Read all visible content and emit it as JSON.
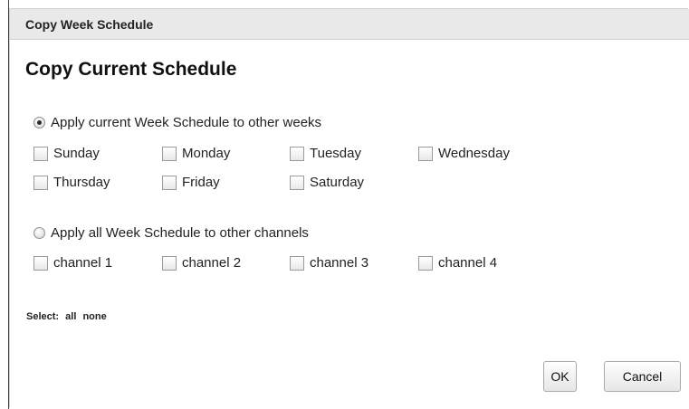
{
  "dialog": {
    "title": "Copy Week Schedule",
    "heading": "Copy Current Schedule"
  },
  "weeks_option": {
    "label": "Apply current Week Schedule to other weeks",
    "selected": true,
    "days": [
      "Sunday",
      "Monday",
      "Tuesday",
      "Wednesday",
      "Thursday",
      "Friday",
      "Saturday"
    ]
  },
  "channels_option": {
    "label": "Apply all Week Schedule to other channels",
    "selected": false,
    "channels": [
      "channel 1",
      "channel 2",
      "channel 3",
      "channel 4"
    ]
  },
  "select": {
    "label": "Select:",
    "all": "all",
    "none": "none"
  },
  "buttons": {
    "ok": "OK",
    "cancel": "Cancel"
  }
}
